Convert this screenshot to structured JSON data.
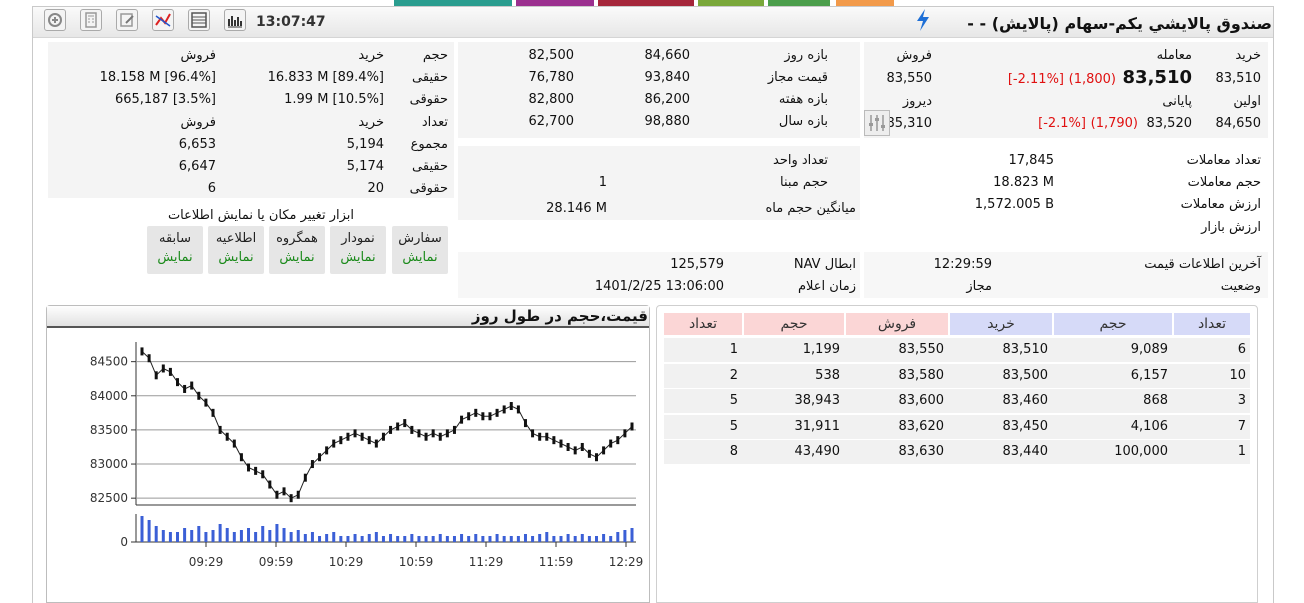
{
  "header": {
    "title": "صندوق پالايشي يكم-سهام (پالايش) - -",
    "clock": "13:07:47",
    "toolbar_icons": [
      "zoom-icon",
      "calculator-icon",
      "note-icon",
      "technical-chart-icon",
      "table-icon",
      "bar-chart-icon"
    ],
    "accent": "#1e6fd6"
  },
  "trade": {
    "kharid_label": "خرید",
    "kharid_value": "83,510",
    "moamele_label": "معامله",
    "moamele_value": "83,510",
    "moamele_change": "(1,800)",
    "moamele_pct": "[-2.11%]",
    "forush_label": "فروش",
    "forush_value": "83,550",
    "avalin_label": "اولین",
    "avalin_value": "84,650",
    "payani_label": "پایانی",
    "payani_value": "83,520",
    "payani_change": "(1,790)",
    "payani_pct": "[-2.1%]",
    "dirooz_label": "دیروز",
    "dirooz_value": "85,310"
  },
  "ranges": [
    {
      "label": "بازه روز",
      "high": "84,660",
      "low": "82,500"
    },
    {
      "label": "قیمت مجاز",
      "high": "93,840",
      "low": "76,780"
    },
    {
      "label": "بازه هفته",
      "high": "86,200",
      "low": "82,800"
    },
    {
      "label": "بازه سال",
      "high": "98,880",
      "low": "62,700"
    }
  ],
  "stats": {
    "count_label": "تعداد معاملات",
    "count_value": "17,845",
    "volume_label": "حجم معاملات",
    "volume_value": "18.823 M",
    "value_label": "ارزش معاملات",
    "value_value": "1,572.005 B",
    "market_label": "ارزش بازار",
    "unit_label": "تعداد واحد",
    "base_label": "حجم مبنا",
    "base_value": "1",
    "avgvol_label": "میانگین حجم ماه",
    "avgvol_value": "28.146 M"
  },
  "info": {
    "last_label": "آخرین اطلاعات قیمت",
    "last_value": "12:29:59",
    "status_label": "وضعیت",
    "status_value": "مجاز",
    "nav_label": "NAV ابطال",
    "nav_value": "125,579",
    "navtime_label": "زمان اعلام",
    "navtime_value": "1401/2/25 13:06:00"
  },
  "clients": {
    "h_hajm": "حجم",
    "h_kharid": "خرید",
    "h_forush": "فروش",
    "haghighi": "حقیقی",
    "hoghoghi": "حقوقی",
    "tedad": "تعداد",
    "majmoo": "مجموع",
    "vol_real_buy": "16.833 M [89.4%]",
    "vol_real_sell": "18.158 M [96.4%]",
    "vol_legal_buy": "1.99 M [10.5%]",
    "vol_legal_sell": "665,187 [3.5%]",
    "cnt_total_buy": "5,194",
    "cnt_total_sell": "6,653",
    "cnt_real_buy": "5,174",
    "cnt_real_sell": "6,647",
    "cnt_legal_buy": "20",
    "cnt_legal_sell": "6"
  },
  "tools": {
    "title": "ابزار تغییر مکان یا نمایش اطلاعات",
    "show": "نمایش",
    "buttons": [
      "سفارش",
      "نمودار",
      "همگروه",
      "اطلاعیه",
      "سابقه"
    ]
  },
  "chart": {
    "title": "قیمت،حجم در طول روز"
  },
  "chart_data": {
    "type": "line",
    "title": "قیمت،حجم در طول روز",
    "xlabel": "",
    "ylabel": "",
    "x_ticks": [
      "09:29",
      "09:59",
      "10:29",
      "10:59",
      "11:29",
      "11:59",
      "12:29"
    ],
    "y_ticks": [
      84500,
      84000,
      83500,
      83000,
      82500
    ],
    "ylim": [
      82400,
      84700
    ],
    "volume_tick": "0",
    "grid": true,
    "series": [
      {
        "values": [
          84650,
          84550,
          84300,
          84400,
          84350,
          84200,
          84100,
          84150,
          84000,
          83900,
          83750,
          83500,
          83400,
          83300,
          83100,
          82950,
          82900,
          82850,
          82700,
          82550,
          82600,
          82500,
          82550,
          82800,
          83000,
          83100,
          83200,
          83300,
          83350,
          83400,
          83450,
          83400,
          83350,
          83300,
          83400,
          83500,
          83550,
          83600,
          83500,
          83450,
          83400,
          83450,
          83400,
          83450,
          83500,
          83650,
          83700,
          83750,
          83700,
          83700,
          83750,
          83800,
          83850,
          83800,
          83600,
          83450,
          83400,
          83400,
          83350,
          83300,
          83250,
          83200,
          83250,
          83150,
          83100,
          83200,
          83300,
          83350,
          83450,
          83550
        ]
      }
    ],
    "volumes": [
      26,
      22,
      16,
      12,
      10,
      10,
      14,
      12,
      16,
      10,
      12,
      18,
      14,
      10,
      12,
      14,
      10,
      16,
      12,
      18,
      14,
      10,
      12,
      8,
      10,
      6,
      8,
      10,
      6,
      6,
      8,
      6,
      8,
      10,
      6,
      8,
      6,
      6,
      8,
      6,
      6,
      6,
      8,
      6,
      6,
      8,
      6,
      8,
      6,
      6,
      8,
      6,
      6,
      6,
      8,
      6,
      8,
      10,
      6,
      6,
      8,
      6,
      8,
      6,
      6,
      8,
      6,
      10,
      12,
      14
    ]
  },
  "orderbook": {
    "headers_buy": [
      "تعداد",
      "حجم",
      "خرید"
    ],
    "headers_sell": [
      "فروش",
      "حجم",
      "تعداد"
    ],
    "buy_header_color": "#d6daf8",
    "sell_header_color": "#fbd6d6",
    "rows": [
      {
        "buy_count": "6",
        "buy_vol": "9,089",
        "buy_price": "83,510",
        "sell_price": "83,550",
        "sell_vol": "1,199",
        "sell_count": "1"
      },
      {
        "buy_count": "10",
        "buy_vol": "6,157",
        "buy_price": "83,500",
        "sell_price": "83,580",
        "sell_vol": "538",
        "sell_count": "2"
      },
      {
        "buy_count": "3",
        "buy_vol": "868",
        "buy_price": "83,460",
        "sell_price": "83,600",
        "sell_vol": "38,943",
        "sell_count": "5"
      },
      {
        "buy_count": "7",
        "buy_vol": "4,106",
        "buy_price": "83,450",
        "sell_price": "83,620",
        "sell_vol": "31,911",
        "sell_count": "5"
      },
      {
        "buy_count": "1",
        "buy_vol": "100,000",
        "buy_price": "83,440",
        "sell_price": "83,630",
        "sell_vol": "43,490",
        "sell_count": "8"
      }
    ]
  }
}
